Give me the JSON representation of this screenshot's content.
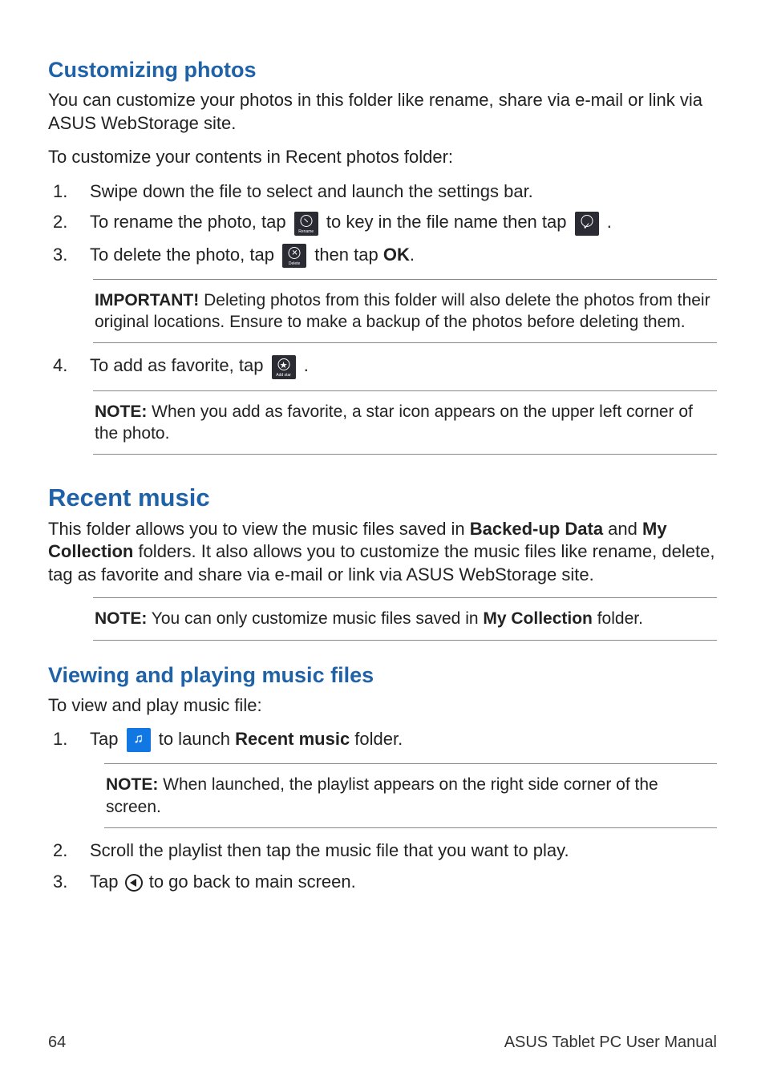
{
  "section1": {
    "heading": "Customizing photos",
    "intro": "You can customize your photos in this folder like rename, share via e-mail or link via ASUS WebStorage site.",
    "lead": "To customize your contents in Recent photos folder:",
    "step1": "Swipe down the file to select and launch the settings bar.",
    "step2_a": "To rename the photo, tap ",
    "step2_b": " to key in the file name then tap ",
    "step2_c": ".",
    "step3_a": "To delete the photo, tap ",
    "step3_b": " then tap ",
    "step3_ok": "OK",
    "step3_c": ".",
    "important_lead": "IMPORTANT!",
    "important_body": "  Deleting photos from this folder will also delete the photos from their original locations. Ensure to make a backup of the photos before deleting them.",
    "step4_a": "To add as favorite, tap ",
    "step4_b": ".",
    "note1_lead": "NOTE:",
    "note1_body": "  When you add as favorite, a star icon appears on the upper left corner of the photo.",
    "icon_rename_label": "Rename",
    "icon_delete_label": "Delete",
    "icon_addstar_label": "Add star"
  },
  "section2": {
    "heading": "Recent music",
    "intro_a": "This folder allows you to view the music files saved in ",
    "intro_b1": "Backed-up Data",
    "intro_c": " and ",
    "intro_b2": "My Collection",
    "intro_d": " folders. It also allows you to customize the music files like rename, delete, tag as favorite and share via e-mail or link via ASUS WebStorage site.",
    "note2_lead": "NOTE:",
    "note2_a": "  You can only customize music files saved in ",
    "note2_b": "My Collection",
    "note2_c": " folder."
  },
  "section3": {
    "heading": "Viewing and playing music files",
    "lead": "To view and play music file:",
    "step1_a": "Tap ",
    "step1_b": " to launch ",
    "step1_bold": "Recent music",
    "step1_c": " folder.",
    "note3_lead": "NOTE:",
    "note3_body": "  When launched, the playlist appears on the right side corner of the screen.",
    "step2": "Scroll the playlist then tap the music file that you want to play.",
    "step3_a": "Tap ",
    "step3_b": " to go back to main screen."
  },
  "footer": {
    "page": "64",
    "title": "ASUS Tablet PC User Manual"
  },
  "numbers": {
    "n1": "1.",
    "n2": "2.",
    "n3": "3.",
    "n4": "4."
  }
}
